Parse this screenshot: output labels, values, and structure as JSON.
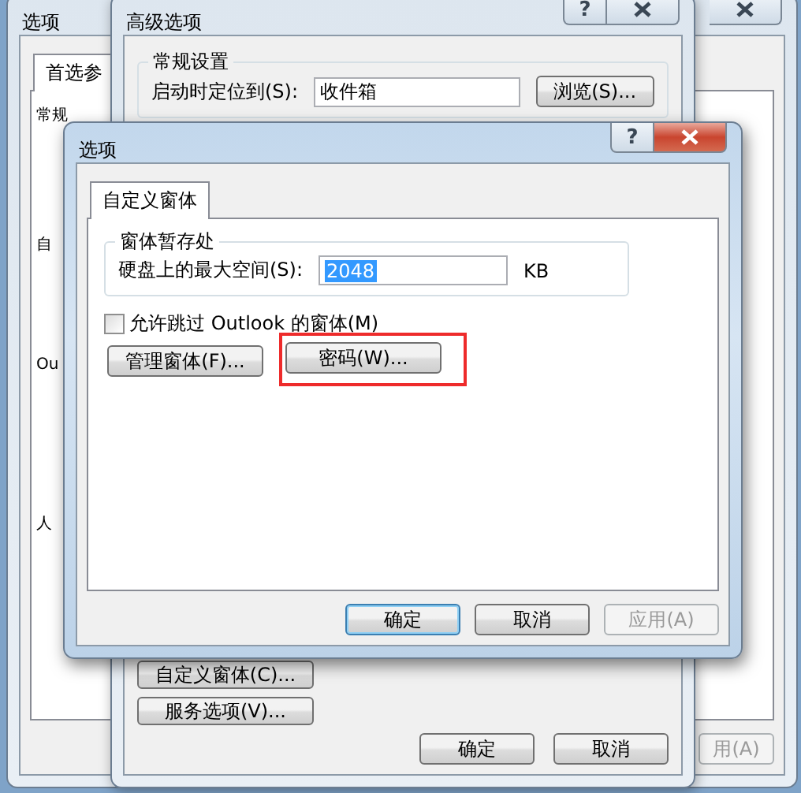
{
  "back_window": {
    "title": "选项",
    "tabs": [
      {
        "label": "首选参",
        "selected": true
      }
    ],
    "section_label": "常规",
    "fragments": [
      "自",
      "Ou",
      "人"
    ],
    "apply_button": {
      "label": "用(A)",
      "disabled": true
    }
  },
  "middle_window": {
    "title": "高级选项",
    "help": "?",
    "group": {
      "label": "常规设置",
      "field_label": "启动时定位到(S):",
      "value": "收件箱",
      "button": "浏览(S)..."
    },
    "side_buttons": [
      "自定义窗体(C)...",
      "服务选项(V)..."
    ],
    "buttons": [
      {
        "label": "确定",
        "default": false
      },
      {
        "label": "取消",
        "default": false
      }
    ]
  },
  "front_window": {
    "title": "选项",
    "help": "?",
    "active": true,
    "tabs": [
      {
        "label": "自定义窗体",
        "selected": true
      }
    ],
    "group": {
      "label": "窗体暂存处",
      "field_label": "硬盘上的最大空间(S):",
      "value": "2048",
      "unit": "KB"
    },
    "checkbox": {
      "label": "允许跳过 Outlook 的窗体(M)",
      "checked": false
    },
    "buttons": [
      {
        "label": "管理窗体(F)...",
        "highlighted": false
      },
      {
        "label": "密码(W)...",
        "highlighted": true
      }
    ],
    "footer_buttons": [
      {
        "label": "确定",
        "default": true,
        "disabled": false
      },
      {
        "label": "取消",
        "default": false,
        "disabled": false
      },
      {
        "label": "应用(A)",
        "default": false,
        "disabled": true
      }
    ]
  }
}
